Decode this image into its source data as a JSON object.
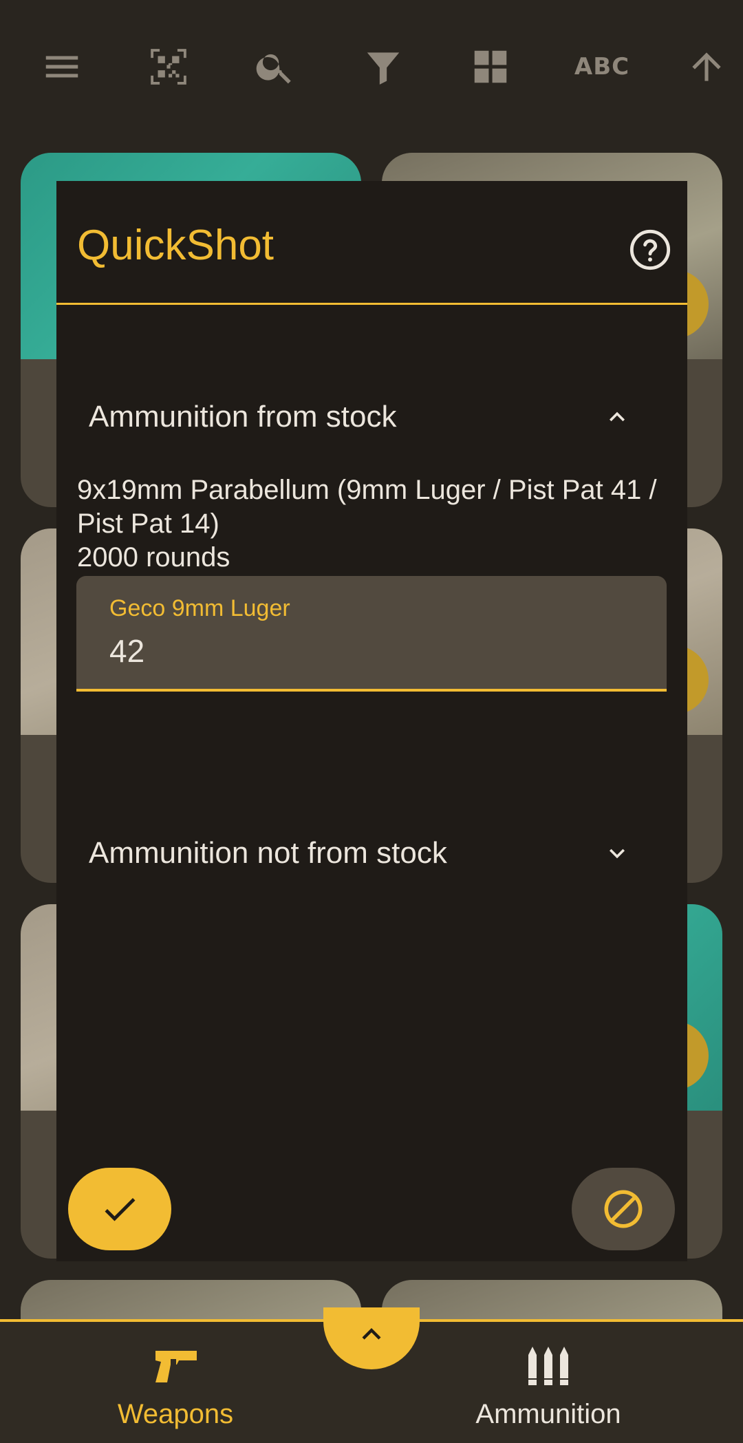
{
  "toolbar": {
    "icons": [
      "menu-icon",
      "qr-code-icon",
      "search-icon",
      "filter-icon",
      "grid-view-icon",
      "sort-abc-icon",
      "sort-arrow-up-icon"
    ],
    "sort_label": "ABC"
  },
  "dialog": {
    "title": "QuickShot",
    "help_icon": "help-icon",
    "section_stock": {
      "label": "Ammunition from stock",
      "expanded": true
    },
    "stock_item": {
      "caliber": "9x19mm Parabellum (9mm Luger / Pist Pat 41 / Pist Pat 14)",
      "rounds": "2000 rounds"
    },
    "amount_field": {
      "label": "Geco 9mm Luger",
      "value": "42"
    },
    "section_no_stock": {
      "label": "Ammunition not from stock",
      "expanded": false
    },
    "confirm_icon": "check-icon",
    "cancel_icon": "block-icon"
  },
  "bottom_nav": {
    "weapons_label": "Weapons",
    "ammunition_label": "Ammunition",
    "active": "Weapons",
    "center_icon": "chevron-up-icon"
  },
  "colors": {
    "accent": "#f2bc33",
    "background": "#29251f",
    "dialog": "#1f1b17",
    "field": "#524a3f",
    "icon_muted": "#8f877b"
  }
}
